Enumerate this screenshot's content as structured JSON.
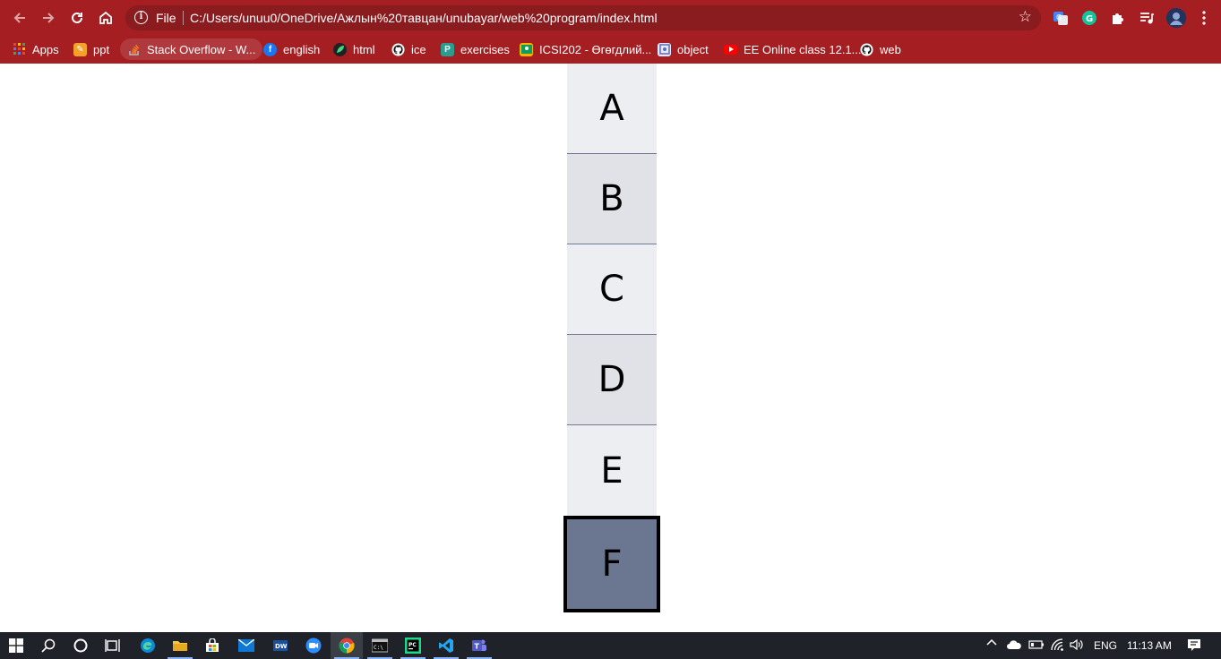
{
  "browser": {
    "url_scheme_label": "File",
    "url": "C:/Users/unuu0/OneDrive/Ажлын%20тавцан/unubayar/web%20program/index.html",
    "bookmarks": [
      {
        "label": "Apps",
        "icon": "apps-grid-icon",
        "color": "#e8453c"
      },
      {
        "label": "ppt",
        "icon": "slides-icon",
        "color": "#f4a12b"
      },
      {
        "label": "Stack Overflow - W...",
        "icon": "stackoverflow-icon",
        "color": "#f48024"
      },
      {
        "label": "english",
        "icon": "facebook-icon",
        "color": "#1877f2"
      },
      {
        "label": "html",
        "icon": "leaf-icon",
        "color": "#222222"
      },
      {
        "label": "ice",
        "icon": "github-icon",
        "color": "#111111"
      },
      {
        "label": "exercises",
        "icon": "exercises-icon",
        "color": "#2a9d8f"
      },
      {
        "label": "ICSI202 - Өгөгдлий...",
        "icon": "classroom-icon",
        "color": "#f6b400"
      },
      {
        "label": "object",
        "icon": "object-icon",
        "color": "#5c6bc0"
      },
      {
        "label": "EE Online class 12.1...",
        "icon": "youtube-icon",
        "color": "#ff0000"
      },
      {
        "label": "web",
        "icon": "github-icon",
        "color": "#111111"
      }
    ]
  },
  "page": {
    "boxes": [
      "A",
      "B",
      "C",
      "D",
      "E"
    ],
    "highlighted_box": "F",
    "colors": {
      "box_light": "#eceef2",
      "box_mid": "#e0e2e7",
      "highlight": "#6b7690",
      "highlight_border": "#000000"
    }
  },
  "taskbar": {
    "language": "ENG",
    "time": "11:13 AM"
  },
  "theme": {
    "chrome_red": "#a41e22",
    "taskbar_bg": "#1f2228"
  }
}
